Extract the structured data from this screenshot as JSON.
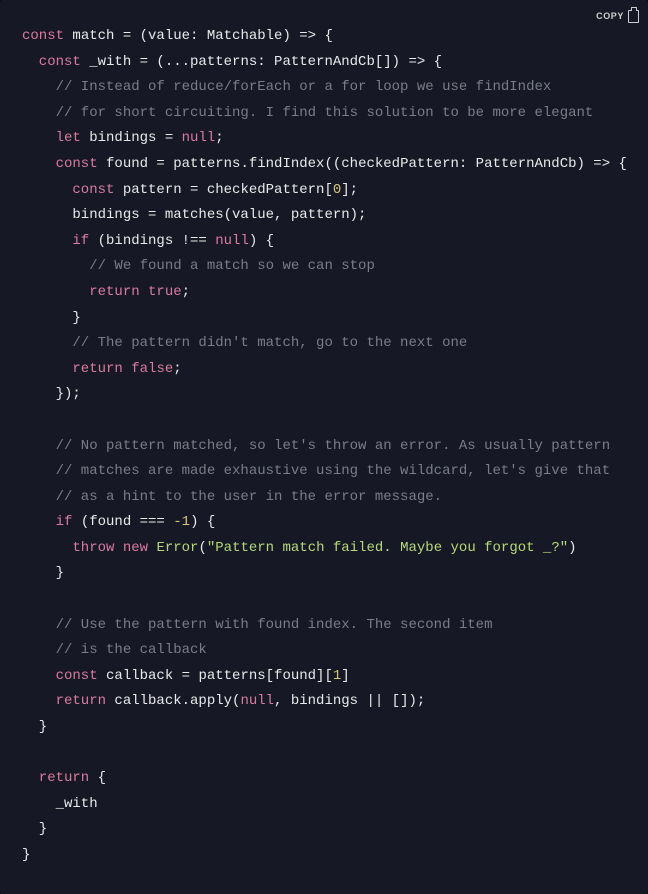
{
  "copy": {
    "label": "COPY"
  },
  "lines": {
    "l1_a": "const",
    "l1_b": " match = (value: Matchable) => {",
    "l2_a": "  const",
    "l2_b": " _with = (...patterns: PatternAndCb[]) => {",
    "l3": "    // Instead of reduce/forEach or a for loop we use findIndex",
    "l4": "    // for short circuiting. I find this solution to be more elegant",
    "l5_a": "    let",
    "l5_b": " bindings = ",
    "l5_c": "null",
    "l5_d": ";",
    "l6_a": "    const",
    "l6_b": " found = patterns.findIndex((checkedPattern: PatternAndCb) => {",
    "l7_a": "      const",
    "l7_b": " pattern = checkedPattern[",
    "l7_c": "0",
    "l7_d": "];",
    "l8": "      bindings = matches(value, pattern);",
    "l9_a": "      if",
    "l9_b": " (bindings !== ",
    "l9_c": "null",
    "l9_d": ") {",
    "l10": "        // We found a match so we can stop",
    "l11_a": "        return",
    "l11_b": " ",
    "l11_c": "true",
    "l11_d": ";",
    "l12": "      }",
    "l13": "      // The pattern didn't match, go to the next one",
    "l14_a": "      return",
    "l14_b": " ",
    "l14_c": "false",
    "l14_d": ";",
    "l15": "    });",
    "l16": "",
    "l17": "    // No pattern matched, so let's throw an error. As usually pattern",
    "l18": "    // matches are made exhaustive using the wildcard, let's give that",
    "l19": "    // as a hint to the user in the error message.",
    "l20_a": "    if",
    "l20_b": " (found === ",
    "l20_c": "-1",
    "l20_d": ") {",
    "l21_a": "      throw",
    "l21_b": " ",
    "l21_c": "new",
    "l21_d": " ",
    "l21_e": "Error",
    "l21_f": "(",
    "l21_g": "\"Pattern match failed. Maybe you forgot _?\"",
    "l21_h": ")",
    "l22": "    }",
    "l23": "",
    "l24": "    // Use the pattern with found index. The second item",
    "l25": "    // is the callback",
    "l26_a": "    const",
    "l26_b": " callback = patterns[found][",
    "l26_c": "1",
    "l26_d": "]",
    "l27_a": "    return",
    "l27_b": " callback.apply(",
    "l27_c": "null",
    "l27_d": ", bindings || []);",
    "l28": "  }",
    "l29": "",
    "l30_a": "  return",
    "l30_b": " {",
    "l31": "    _with",
    "l32": "  }",
    "l33": "}"
  }
}
